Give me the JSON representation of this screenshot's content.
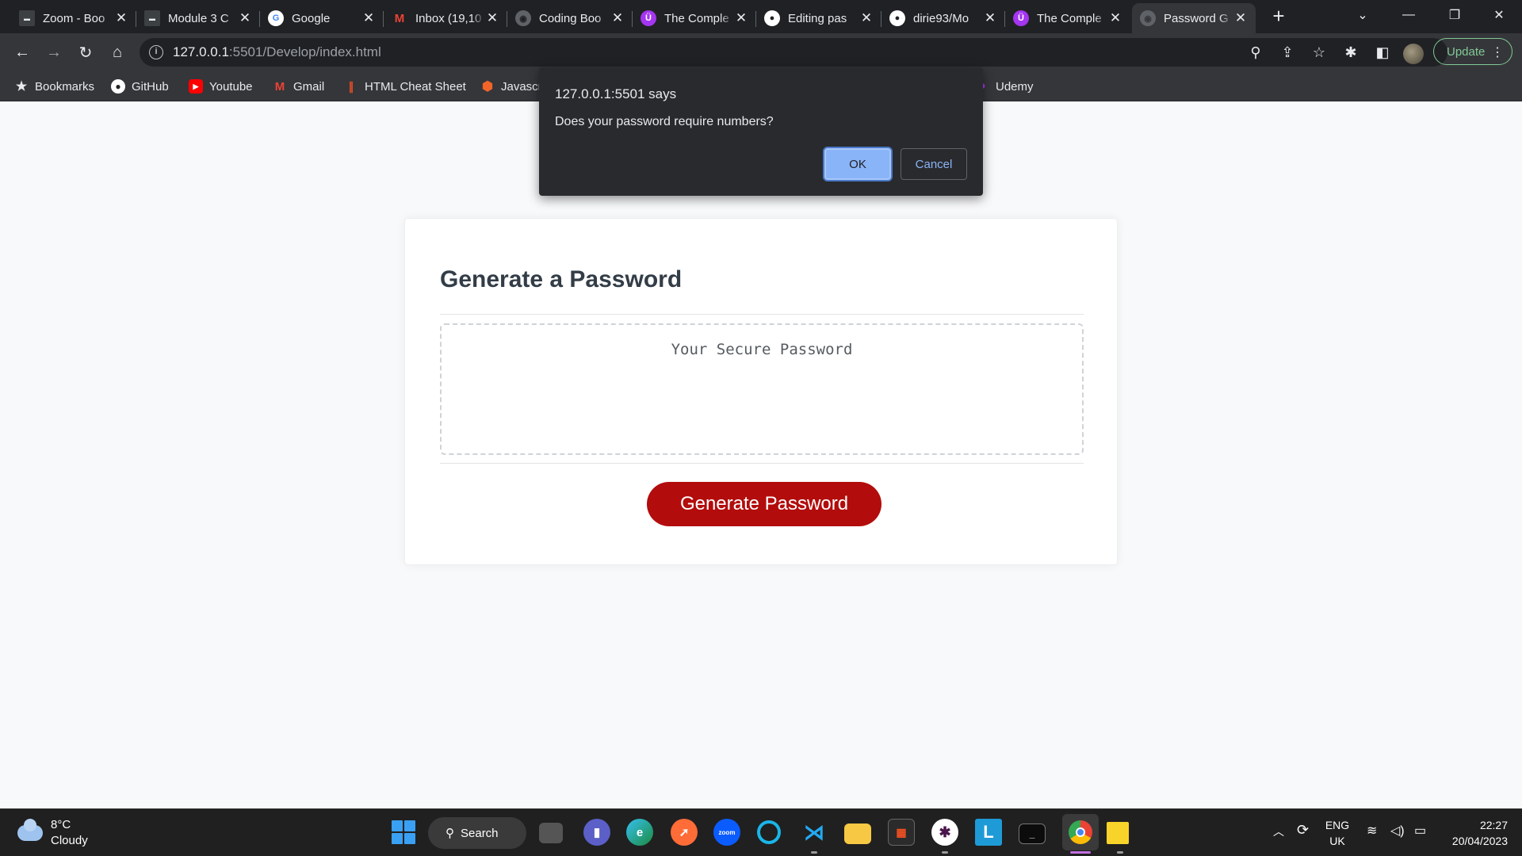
{
  "browser": {
    "tabs": [
      {
        "title": "Zoom - Boo",
        "icon": "zoom-thumb-icon",
        "color": "#3c4043",
        "glyph": "▬"
      },
      {
        "title": "Module 3 C",
        "icon": "page-thumb-icon",
        "color": "#3c4043",
        "glyph": "▬"
      },
      {
        "title": "Google",
        "icon": "google-icon",
        "color": "#ffffff",
        "glyph": "G"
      },
      {
        "title": "Inbox (19,10",
        "icon": "gmail-icon",
        "color": "#202124",
        "glyph": "M"
      },
      {
        "title": "Coding Boo",
        "icon": "globe-icon",
        "color": "#5f6368",
        "glyph": "◉"
      },
      {
        "title": "The Comple",
        "icon": "udemy-icon",
        "color": "#a435f0",
        "glyph": "Ü"
      },
      {
        "title": "Editing pas",
        "icon": "github-icon",
        "color": "#ffffff",
        "glyph": "●"
      },
      {
        "title": "dirie93/Mo",
        "icon": "github-icon",
        "color": "#ffffff",
        "glyph": "●"
      },
      {
        "title": "The Comple",
        "icon": "udemy-icon",
        "color": "#a435f0",
        "glyph": "Ü"
      },
      {
        "title": "Password G",
        "icon": "globe-icon",
        "color": "#5f6368",
        "glyph": "◉"
      }
    ],
    "url_host": "127.0.0.1",
    "url_rest": ":5501/Develop/index.html",
    "update_label": "Update",
    "bookmarks": [
      {
        "label": "Bookmarks",
        "icon": "star-icon",
        "glyph": "★",
        "color": "transparent"
      },
      {
        "label": "GitHub",
        "icon": "github-icon",
        "glyph": "●",
        "color": "transparent"
      },
      {
        "label": "Youtube",
        "icon": "youtube-icon",
        "glyph": "▶",
        "color": "#ff0000"
      },
      {
        "label": "Gmail",
        "icon": "gmail-icon",
        "glyph": "M",
        "color": "transparent"
      },
      {
        "label": "HTML Cheat Sheet",
        "icon": "html-cheatsheet-icon",
        "glyph": "∥",
        "color": "transparent"
      },
      {
        "label": "Javascri",
        "icon": "javascript-icon",
        "glyph": "⬢",
        "color": "transparent"
      },
      {
        "label": "Udemy",
        "icon": "udemy-icon",
        "glyph": "●",
        "color": "transparent"
      }
    ]
  },
  "dialog": {
    "title": "127.0.0.1:5501 says",
    "message": "Does your password require numbers?",
    "ok_label": "OK",
    "cancel_label": "Cancel"
  },
  "page": {
    "heading": "Generate a Password",
    "password_placeholder": "Your Secure Password",
    "generate_label": "Generate Password",
    "accent": "#b30c0c"
  },
  "taskbar": {
    "weather_temp": "8°C",
    "weather_desc": "Cloudy",
    "search_label": "Search",
    "apps": [
      "task-view-icon",
      "teams-chat-icon",
      "edge-icon",
      "postman-icon",
      "zoom-icon",
      "cortana-icon",
      "vscode-icon",
      "file-explorer-icon",
      "ms-store-icon",
      "slack-icon",
      "l-app-icon",
      "terminal-icon",
      "chrome-icon",
      "sticky-notes-icon"
    ],
    "lang_top": "ENG",
    "lang_bottom": "UK",
    "time": "22:27",
    "date": "20/04/2023"
  }
}
